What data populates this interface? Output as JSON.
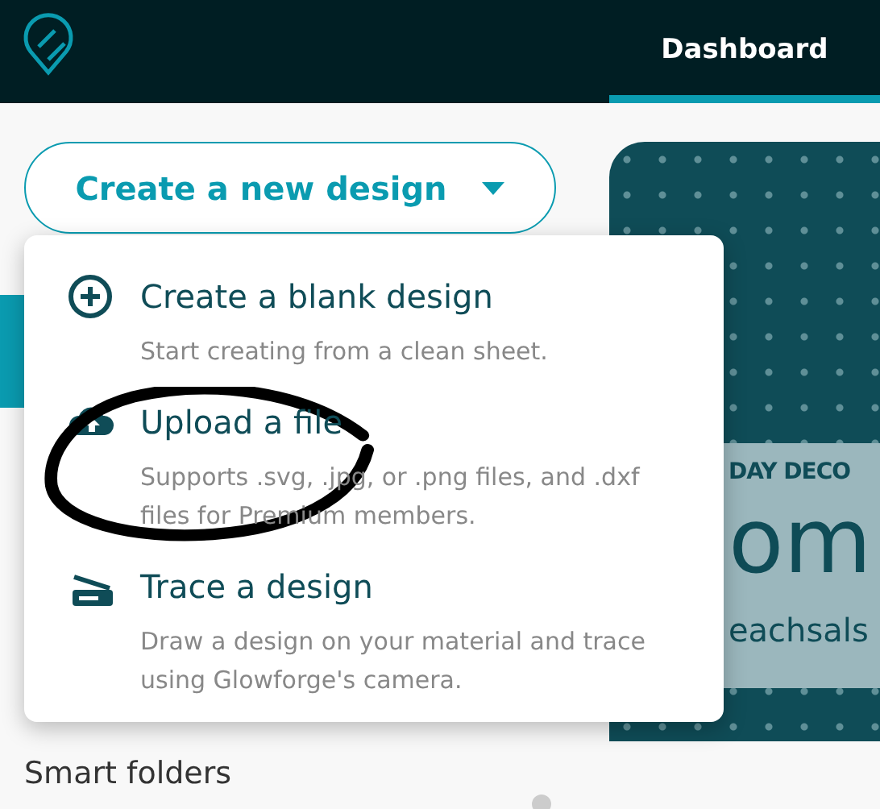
{
  "header": {
    "nav_tabs": [
      {
        "label": "Dashboard",
        "selected": true
      }
    ]
  },
  "create_button": {
    "label": "Create a new design",
    "expanded": true
  },
  "menu": {
    "items": [
      {
        "kind": "blank",
        "title": "Create a blank design",
        "description": "Start creating from a clean sheet."
      },
      {
        "kind": "upload",
        "title": "Upload a file",
        "description": "Supports .svg, .jpg, or .png files, and .dxf files for Premium members."
      },
      {
        "kind": "trace",
        "title": "Trace a design",
        "description": "Draw a design on your material and trace using Glowforge's camera."
      }
    ]
  },
  "sidebar": {
    "section_title": "Smart folders"
  },
  "design_card": {
    "subtitle": "DAY DECO",
    "title": "om",
    "link": "eachsals"
  }
}
